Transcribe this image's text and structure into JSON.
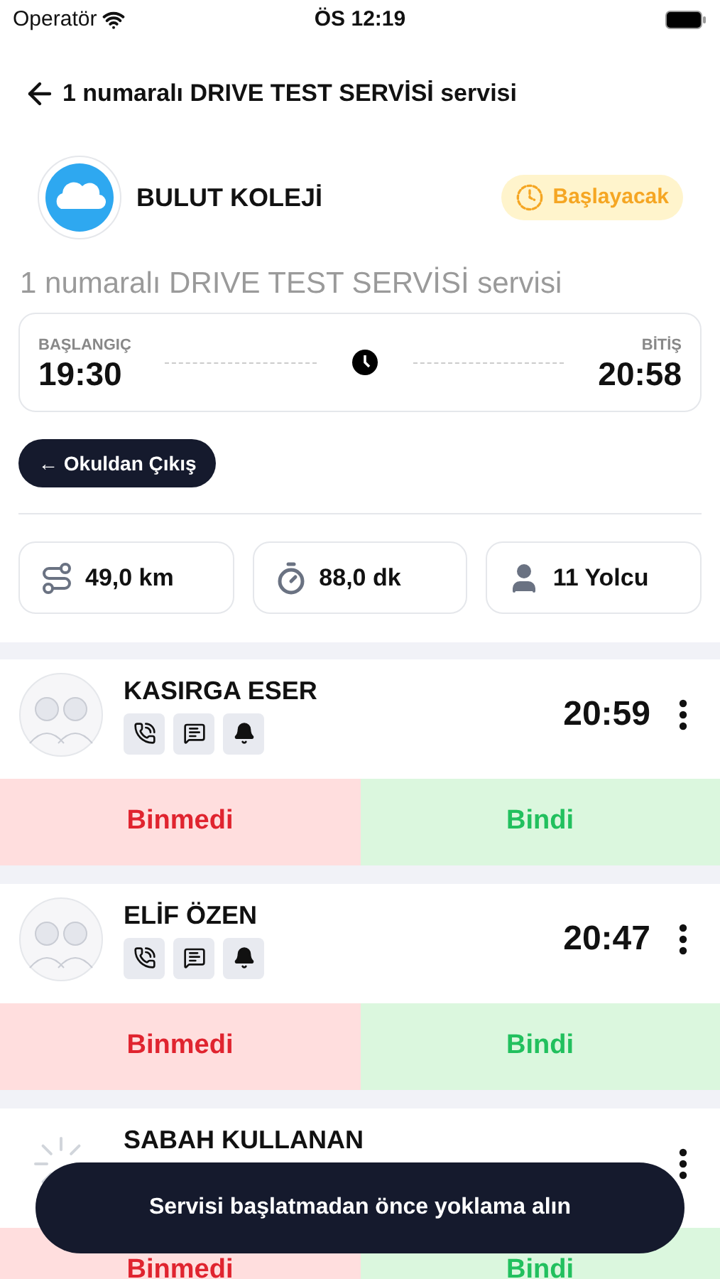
{
  "status_bar": {
    "carrier": "Operatör",
    "time": "ÖS 12:19"
  },
  "header": {
    "title": "1 numaralı DRIVE TEST SERVİSİ servisi"
  },
  "school": {
    "name": "BULUT KOLEJİ",
    "status": "Başlayacak"
  },
  "subtitle": "1 numaralı DRIVE TEST SERVİSİ servisi",
  "schedule": {
    "start_label": "BAŞLANGIÇ",
    "start_time": "19:30",
    "end_label": "BİTİŞ",
    "end_time": "20:58"
  },
  "direction_button": "← Okuldan Çıkış",
  "stats": [
    {
      "kind": "distance",
      "value": "49,0 km"
    },
    {
      "kind": "duration",
      "value": "88,0 dk"
    },
    {
      "kind": "passengers",
      "value": "11 Yolcu"
    }
  ],
  "passengers": [
    {
      "kind": "people",
      "name": "KASIRGA ESER",
      "time": "20:59",
      "absent_label": "Binmedi",
      "present_label": "Bindi"
    },
    {
      "kind": "people",
      "name": "ELİF ÖZEN",
      "time": "20:47",
      "absent_label": "Binmedi",
      "present_label": "Bindi"
    },
    {
      "kind": "loading",
      "name": "SABAH KULLANAN",
      "absent_label": "Binmedi",
      "present_label": "Bindi"
    }
  ],
  "toast": "Servisi başlatmadan önce yoklama alın"
}
